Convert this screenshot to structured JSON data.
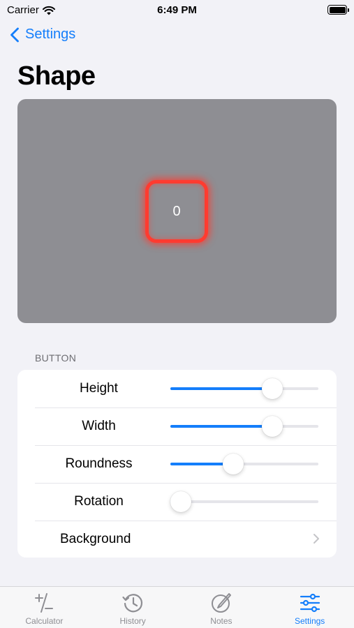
{
  "status_bar": {
    "carrier": "Carrier",
    "time": "6:49 PM"
  },
  "nav": {
    "back_label": "Settings",
    "title": "Shape"
  },
  "preview": {
    "button_value": "0",
    "border_color": "#ff3b30",
    "background_color": "#8e8e93"
  },
  "section": {
    "header": "BUTTON"
  },
  "rows": {
    "height": {
      "label": "Height",
      "value": 0.72
    },
    "width": {
      "label": "Width",
      "value": 0.72
    },
    "roundness": {
      "label": "Roundness",
      "value": 0.41
    },
    "rotation": {
      "label": "Rotation",
      "value": 0.0
    },
    "background": {
      "label": "Background",
      "icon": "chevron-right-icon"
    }
  },
  "tabs": {
    "calculator": {
      "label": "Calculator",
      "icon": "plus-minus-icon"
    },
    "history": {
      "label": "History",
      "icon": "history-clock-icon"
    },
    "notes": {
      "label": "Notes",
      "icon": "pencil-circle-icon"
    },
    "settings": {
      "label": "Settings",
      "icon": "sliders-icon",
      "active": true
    }
  },
  "colors": {
    "accent": "#147efb",
    "background": "#f2f2f7",
    "inactive": "#8e8e93"
  }
}
